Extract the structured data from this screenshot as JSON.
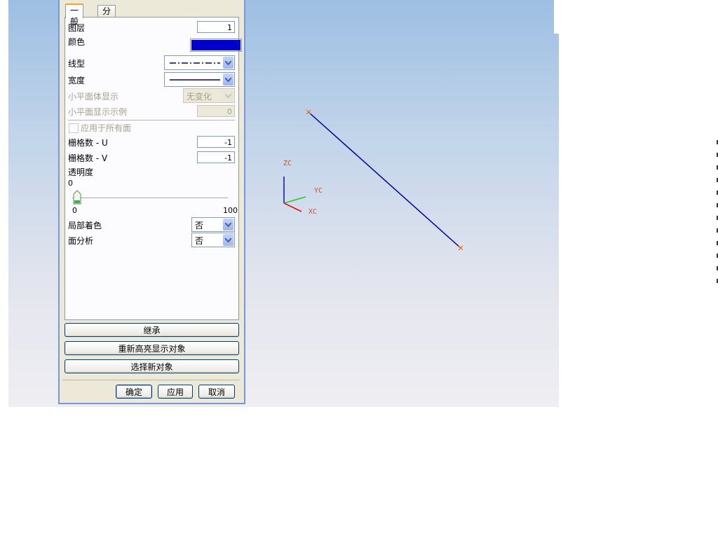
{
  "dialog": {
    "tabs": [
      "一般",
      "分析"
    ],
    "fields": {
      "layer_label": "图层",
      "layer_value": "1",
      "color_label": "颜色",
      "color_value": "#0000cc",
      "linetype_label": "线型",
      "width_label": "宽度",
      "facet_display_label": "小平面体显示",
      "facet_display_value": "无变化",
      "facet_example_label": "小平面显示示例",
      "facet_example_value": "0",
      "apply_all_faces_label": "应用于所有面",
      "grid_u_label": "栅格数 - U",
      "grid_u_value": "-1",
      "grid_v_label": "栅格数 - V",
      "grid_v_value": "-1",
      "transparency_label": "透明度",
      "transparency_value": "0",
      "slider_min": "0",
      "slider_max": "100",
      "partial_shading_label": "局部着色",
      "partial_shading_value": "否",
      "face_analysis_label": "面分析",
      "face_analysis_value": "否"
    },
    "actions": {
      "inherit": "继承",
      "rehighlight": "重新高亮显示对象",
      "select_new": "选择新对象"
    },
    "footer": {
      "ok": "确定",
      "apply": "应用",
      "cancel": "取消"
    }
  },
  "viewport": {
    "axis_labels": {
      "z": "ZC",
      "y": "YC",
      "x": "XC"
    },
    "line_color": "#0000aa",
    "point_marker_color": "#ff6600",
    "triad_colors": {
      "z": "#1a1acc",
      "y": "#22cc22",
      "x": "#dd1111"
    }
  }
}
